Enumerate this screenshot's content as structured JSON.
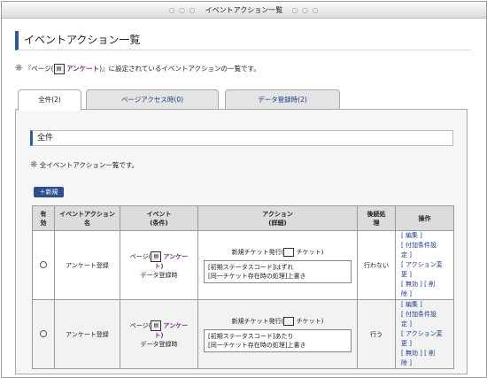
{
  "window": {
    "title": "イベントアクション一覧",
    "dots_left": "○ ○ ○",
    "dots_right": "○ ○ ○"
  },
  "page_title": "イベントアクション一覧",
  "description": {
    "bullet": "❋",
    "open": "『ページ(",
    "link": "アンケート",
    "close": ")』に設定されているイベントアクションの一覧です。"
  },
  "tabs": [
    {
      "label": "全件(2)"
    },
    {
      "label": "ページアクセス時(0)"
    },
    {
      "label": "データ登録時(2)"
    }
  ],
  "section_title": "全件",
  "section_desc": {
    "bullet": "❋",
    "text": "全イベントアクション一覧です。"
  },
  "new_button": "＋新規",
  "table": {
    "headers": {
      "enabled": [
        "有",
        "効"
      ],
      "name": [
        "イベントアクション",
        "名"
      ],
      "event": [
        "イベント",
        "(条件)"
      ],
      "action": [
        "アクション",
        "(詳細)"
      ],
      "post": [
        "後続処",
        "理"
      ],
      "ops": "操作"
    },
    "rows": [
      {
        "name": "アンケート登録",
        "event_pre": "ページ(",
        "event_link": "アンケー",
        "event_link2": "ト)",
        "event_post": "データ登録時",
        "action_name": "新規チケット発行(",
        "action_name_tail": "チケット)",
        "action_lines": [
          "[初期ステータスコード]はずれ",
          "[同一チケット存在時の処理]上書き"
        ],
        "post": "行わない",
        "ops": [
          "[ 編集 ]",
          "[ 付加条件設",
          "定 ]",
          "[ アクション変",
          "更 ]",
          "[ 無効 ] [ 削",
          "除 ]"
        ]
      },
      {
        "name": "アンケート登録",
        "event_pre": "ページ(",
        "event_link": "アンケー",
        "event_link2": "ト)",
        "event_post": "データ登録時",
        "action_name": "新規チケット発行(",
        "action_name_tail": "チケット)",
        "action_lines": [
          "[初期ステータスコード]あたり",
          "[同一チケット存在時の処理]上書き"
        ],
        "post": "行う",
        "ops": [
          "[ 編集 ]",
          "[ 付加条件設",
          "定 ]",
          "[ アクション変",
          "更 ]",
          "[ 無効 ] [ 削",
          "除 ]"
        ]
      }
    ]
  }
}
